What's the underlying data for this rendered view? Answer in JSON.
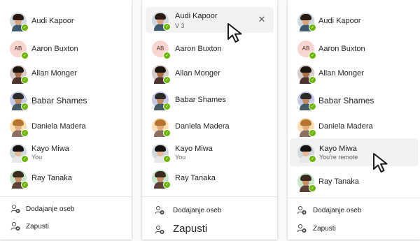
{
  "panels": [
    {
      "people": [
        {
          "name": "Audi Kapoor",
          "status": "available"
        },
        {
          "name": "Aaron Buxton",
          "initials": "AB",
          "status": "available"
        },
        {
          "name": "Allan Monger",
          "status": "available"
        },
        {
          "name": "Babar Shames",
          "status": "available"
        },
        {
          "name": "Daniela Madera",
          "status": "available"
        },
        {
          "name": "Kayo Miwa",
          "subtitle": "You",
          "status": "available"
        },
        {
          "name": "Ray Tanaka",
          "status": "available"
        }
      ],
      "actions": [
        {
          "label": "Dodajanje oseb",
          "icon": "add-person-icon"
        },
        {
          "label": "Zapusti",
          "icon": "leave-icon"
        }
      ]
    },
    {
      "people": [
        {
          "name": "Audi Kapoor",
          "subtitle": "V 3",
          "status": "available"
        },
        {
          "name": "Aaron Buxton",
          "initials": "AB",
          "status": "available"
        },
        {
          "name": "Allan Monger",
          "status": "available"
        },
        {
          "name": "Babar Shames",
          "status": "available"
        },
        {
          "name": "Daniela Madera",
          "status": "available"
        },
        {
          "name": "Kayo Miwa",
          "subtitle": "You",
          "status": "available"
        },
        {
          "name": "Ray Tanaka",
          "status": "available"
        }
      ],
      "actions": [
        {
          "label": "Dodajanje oseb",
          "icon": "add-person-icon"
        },
        {
          "label": "Zapusti",
          "icon": "leave-icon"
        }
      ],
      "close_glyph": "✕"
    },
    {
      "people": [
        {
          "name": "Audi Kapoor",
          "status": "available"
        },
        {
          "name": "Aaron Buxton",
          "initials": "AB",
          "status": "available"
        },
        {
          "name": "Allan Monger",
          "status": "available"
        },
        {
          "name": "Babar Shames",
          "status": "available"
        },
        {
          "name": "Daniela Madera",
          "status": "available"
        },
        {
          "name": "Kayo Miwa",
          "subtitle": "You're remote",
          "status": "available"
        },
        {
          "name": "Ray Tanaka",
          "status": "available"
        }
      ],
      "actions": [
        {
          "label": "Dodajanje oseb",
          "icon": "add-person-icon"
        },
        {
          "label": "Zapusti",
          "icon": "leave-icon"
        }
      ]
    }
  ],
  "colors": {
    "status_available": "#6bb700",
    "hover_background": "#f2f2f2"
  },
  "check_glyph": "✓"
}
